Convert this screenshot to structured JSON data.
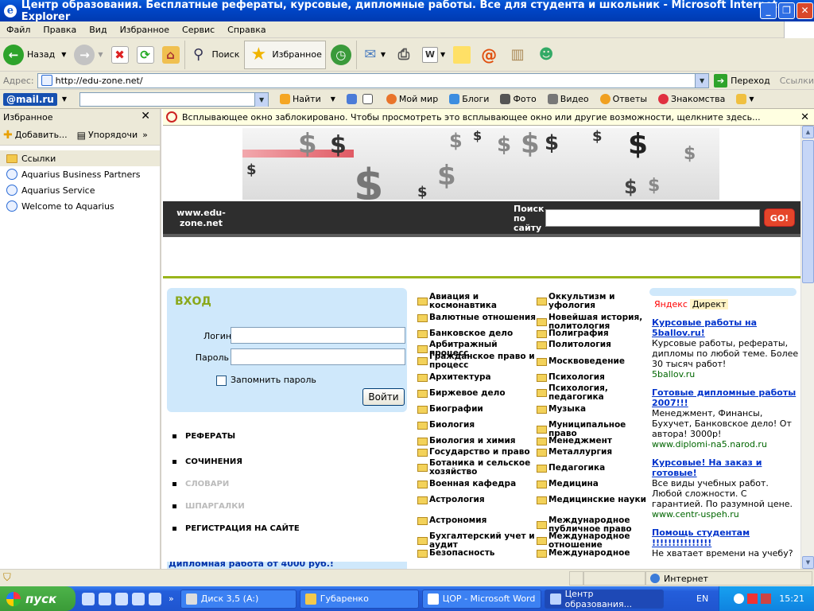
{
  "window": {
    "title": "Центр образования. Бесплатные рефераты, курсовые, дипломные работы. Все для студента и школьник - Microsoft Internet Explorer"
  },
  "menu": [
    "Файл",
    "Правка",
    "Вид",
    "Избранное",
    "Сервис",
    "Справка"
  ],
  "toolbar": {
    "back": "Назад",
    "search": "Поиск",
    "favorites": "Избранное"
  },
  "address": {
    "label": "Адрес:",
    "url": "http://edu-zone.net/",
    "go": "Переход",
    "links": "Ссылки"
  },
  "mailbar": {
    "logo": "@mail.ru",
    "items": [
      "Найти",
      "Мой мир",
      "Блоги",
      "Фото",
      "Видео",
      "Ответы",
      "Знакомства"
    ]
  },
  "favpanel": {
    "title": "Избранное",
    "add": "Добавить...",
    "organize": "Упорядочи",
    "items": [
      "Ссылки",
      "Aquarius Business Partners",
      "Aquarius Service",
      "Welcome to Aquarius"
    ]
  },
  "infobar": {
    "text": "Всплывающее окно заблокировано. Чтобы просмотреть это всплывающее окно или другие возможности, щелкните здесь..."
  },
  "site": {
    "name": "www.edu-zone.net",
    "search_label": "Поиск по сайту",
    "go": "GO!"
  },
  "login": {
    "title": "ВХОД",
    "login_label": "Логин",
    "password_label": "Пароль",
    "remember": "Запомнить пароль",
    "submit": "Войти"
  },
  "nav": [
    {
      "label": "РЕФЕРАТЫ",
      "disabled": false
    },
    {
      "label": "СОЧИНЕНИЯ",
      "disabled": false
    },
    {
      "label": "СЛОВАРИ",
      "disabled": true
    },
    {
      "label": "ШПАРГАЛКИ",
      "disabled": true
    },
    {
      "label": "РЕГИСТРАЦИЯ НА САЙТЕ",
      "disabled": false
    }
  ],
  "promo": "Дипломная работа от 4000 руб.!",
  "categories_left": [
    "Авиация и космонавтика",
    "Валютные отношения",
    "Банковское дело",
    "Арбитражный процесс",
    "Гражданское право и процесс",
    "Архитектура",
    "Биржевое дело",
    "Биографии",
    "Биология",
    "Биология и химия",
    "Государство и право",
    "Ботаника и сельское хозяйство",
    "Военная кафедра",
    "Астрология",
    "Астрономия",
    "Бухгалтерский учет и аудит",
    "Безопасность"
  ],
  "categories_right": [
    "Оккультизм и уфология",
    "Новейшая история, политология",
    "Полиграфия",
    "Политология",
    "Москвоведение",
    "Психология",
    "Психология, педагогика",
    "Музыка",
    "Муниципальное право",
    "Менеджмент",
    "Металлургия",
    "Педагогика",
    "Медицина",
    "Медицинские науки",
    "Международное публичное право",
    "Международное отношение",
    "Международное"
  ],
  "ads": {
    "yandex": "Яндекс",
    "direct": "Директ",
    "items": [
      {
        "title": "Курсовые работы на 5ballov.ru!",
        "text": "Курсовые работы, рефераты, дипломы по любой теме. Более 30 тысяч работ!",
        "url": "5ballov.ru"
      },
      {
        "title": "Готовые дипломные работы 2007!!!",
        "text": "Менеджмент, Финансы, Бухучет, Банковское дело! От автора! 3000р!",
        "url": "www.diplomi-na5.narod.ru"
      },
      {
        "title": "Курсовые! На заказ и готовые!",
        "text": "Все виды учебных работ. Любой сложности. С гарантией. По разумной цене.",
        "url": "www.centr-uspeh.ru"
      },
      {
        "title": "Помощь студентам !!!!!!!!!!!!!!!",
        "text": "Не хватает времени на учебу?",
        "url": ""
      }
    ]
  },
  "status": {
    "zone": "Интернет"
  },
  "taskbar": {
    "start": "пуск",
    "tasks": [
      "Диск 3,5 (A:)",
      "Губаренко",
      "ЦОР - Microsoft Word",
      "Центр образования..."
    ],
    "lang": "EN",
    "clock": "15:21"
  }
}
